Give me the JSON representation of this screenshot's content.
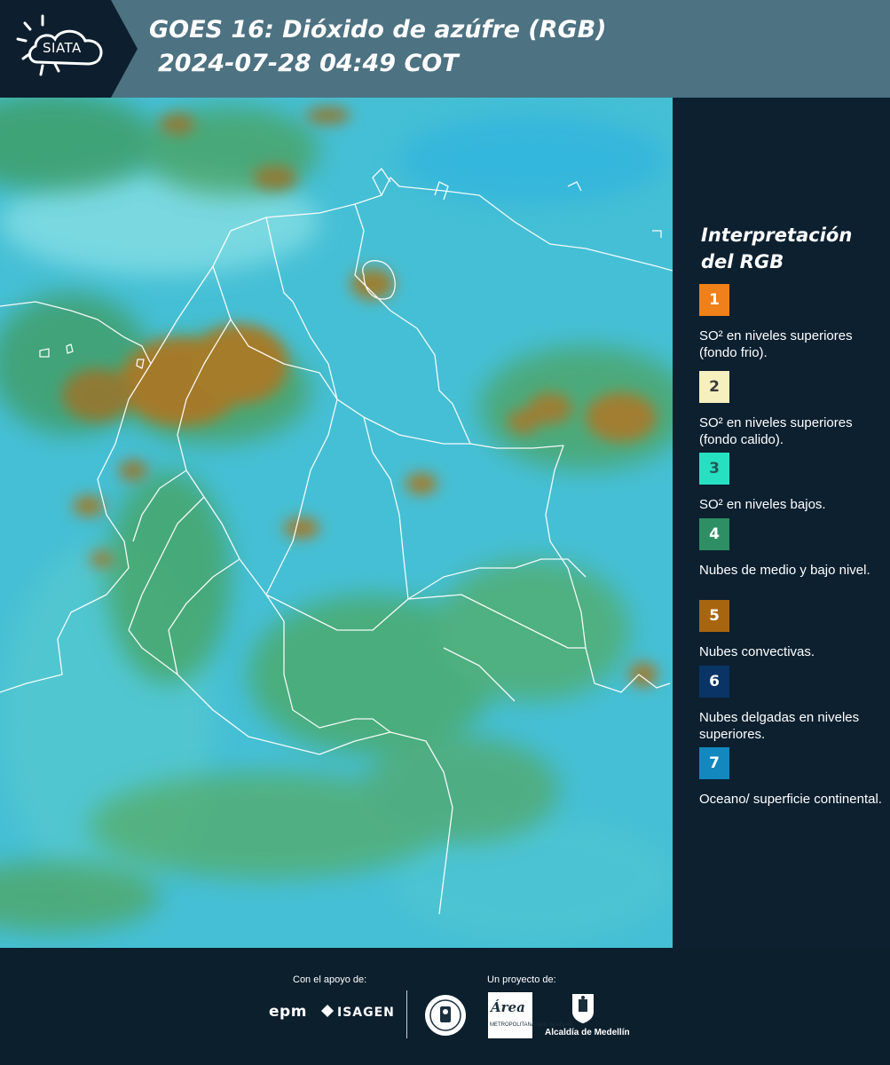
{
  "header": {
    "logo_text": "SIATA",
    "title_line1": "GOES 16: Dióxido de azúfre (RGB)",
    "title_line2": "2024-07-28 04:49 COT"
  },
  "map": {
    "background_color": "#3fb7cf",
    "border_color": "#ffffff",
    "icon": "satellite-map"
  },
  "legend": {
    "title": "Interpretación del RGB",
    "items": [
      {
        "number": "1",
        "color": "#f0801a",
        "text_color": "#ffffff",
        "label": "SO² en niveles superiores (fondo frio)."
      },
      {
        "number": "2",
        "color": "#f6efbe",
        "text_color": "#3a3a3a",
        "label": "SO² en niveles superiores (fondo calido)."
      },
      {
        "number": "3",
        "color": "#27e0c2",
        "text_color": "#1f5b55",
        "label": "SO² en niveles bajos."
      },
      {
        "number": "4",
        "color": "#2f8f64",
        "text_color": "#ffffff",
        "label": "Nubes de medio y bajo nivel."
      },
      {
        "number": "5",
        "color": "#a8650f",
        "text_color": "#ffffff",
        "label": "Nubes convectivas."
      },
      {
        "number": "6",
        "color": "#0b3466",
        "text_color": "#ffffff",
        "label": "Nubes delgadas en niveles superiores."
      },
      {
        "number": "7",
        "color": "#1288be",
        "text_color": "#ffffff",
        "label": "Oceano/ superficie continental."
      }
    ]
  },
  "footer": {
    "support_label": "Con el apoyo de:",
    "project_label": "Un proyecto de:",
    "epm": "epm",
    "isagen": "ISAGEN",
    "area_logo_text": "Área",
    "area_sub": "METROPOLITANA Valle de Aburrá",
    "alcaldia": "Alcaldía de Medellín"
  }
}
